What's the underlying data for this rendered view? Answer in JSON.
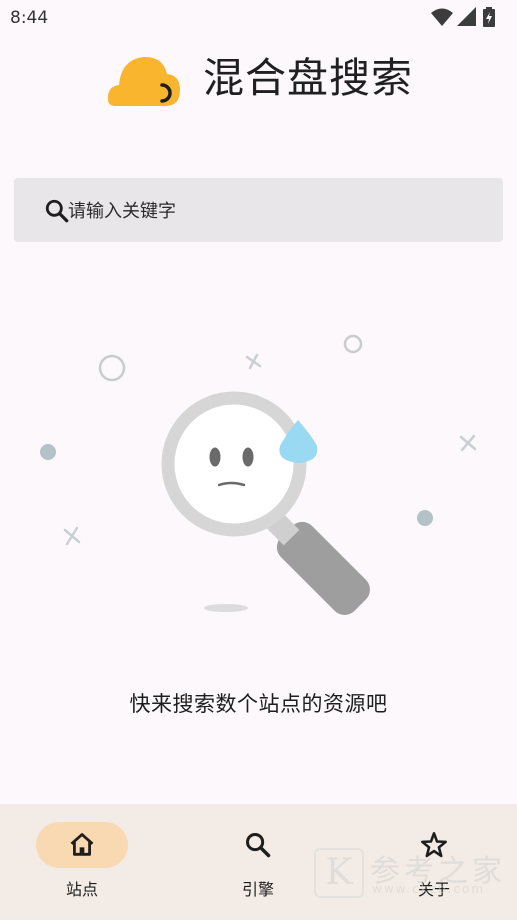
{
  "status_bar": {
    "time": "8:44",
    "icons": [
      "wifi-icon",
      "signal-icon",
      "battery-charging-icon"
    ]
  },
  "header": {
    "title": "混合盘搜索",
    "logo_icon": "cloud-logo-icon",
    "logo_color": "#f9b52e"
  },
  "search": {
    "placeholder": "请输入关键字",
    "value": ""
  },
  "empty_state": {
    "illustration_icon": "magnifier-sad-face-icon",
    "message": "快来搜索数个站点的资源吧"
  },
  "bottom_nav": {
    "items": [
      {
        "label": "站点",
        "icon": "home-icon",
        "active": true
      },
      {
        "label": "引擎",
        "icon": "search-icon",
        "active": false
      },
      {
        "label": "关于",
        "icon": "star-icon",
        "active": false
      }
    ]
  },
  "watermark": {
    "letter": "K",
    "text": "参考之家",
    "url": "www.ckzb.com"
  },
  "colors": {
    "background": "#fdf8fb",
    "accent": "#f9d9b2",
    "nav_background": "#f3ece6",
    "search_background": "#e8e6e9"
  }
}
